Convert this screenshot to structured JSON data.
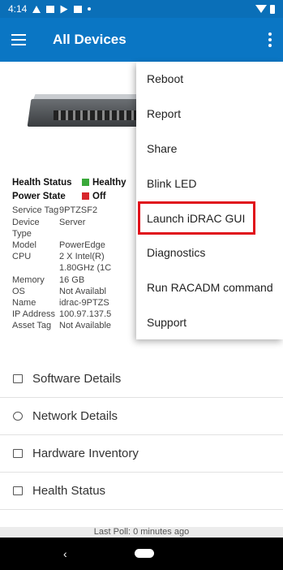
{
  "status_bar": {
    "time": "4:14"
  },
  "app_bar": {
    "title": "All Devices"
  },
  "device": {
    "health_status_label": "Health Status",
    "health_status_value": "Healthy",
    "power_state_label": "Power State",
    "power_state_value": "Off",
    "fields": [
      {
        "label": "Service Tag",
        "value": "9PTZSF2"
      },
      {
        "label": "Device Type",
        "value": "Server"
      },
      {
        "label": "Model",
        "value": "PowerEdge"
      },
      {
        "label": "CPU",
        "value": "2 X Intel(R)"
      },
      {
        "label": "",
        "value": "1.80GHz (1C"
      },
      {
        "label": "Memory",
        "value": "16 GB"
      },
      {
        "label": "OS",
        "value": "Not Availabl"
      },
      {
        "label": "Name",
        "value": "idrac-9PTZS"
      },
      {
        "label": "IP Address",
        "value": "100.97.137.5"
      },
      {
        "label": "Asset Tag",
        "value": "Not Available"
      }
    ]
  },
  "sections": [
    {
      "label": "Software Details",
      "icon": "download-box-icon"
    },
    {
      "label": "Network Details",
      "icon": "network-globe-icon"
    },
    {
      "label": "Hardware Inventory",
      "icon": "download-box-icon"
    },
    {
      "label": "Health Status",
      "icon": "pulse-chart-icon"
    }
  ],
  "footer": {
    "last_poll": "Last Poll: 0 minutes ago"
  },
  "menu": {
    "items": [
      "Reboot",
      "Report",
      "Share",
      "Blink LED",
      "Launch iDRAC GUI",
      "Diagnostics",
      "Run RACADM command",
      "Support"
    ],
    "highlighted": "Launch iDRAC GUI"
  },
  "colors": {
    "app_bar": "#0a76c4",
    "status_bar": "#0a6fb8",
    "healthy": "#3aa93a",
    "off": "#d7262b",
    "highlight": "#e0101a"
  }
}
